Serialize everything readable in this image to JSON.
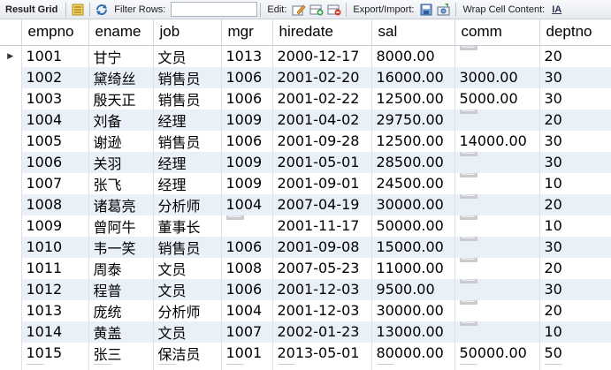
{
  "toolbar": {
    "result_grid_label": "Result Grid",
    "filter_rows_label": "Filter Rows:",
    "filter_value": "",
    "edit_label": "Edit:",
    "export_import_label": "Export/Import:",
    "wrap_cell_label": "Wrap Cell Content:",
    "wrap_icon_text": "IA"
  },
  "grid": {
    "columns": [
      "empno",
      "ename",
      "job",
      "mgr",
      "hiredate",
      "sal",
      "comm",
      "deptno"
    ],
    "null_text": "NULL",
    "current_row_marker": "▶",
    "rows": [
      [
        "1001",
        "甘宁",
        "文员",
        "1013",
        "2000-12-17",
        "8000.00",
        null,
        "20"
      ],
      [
        "1002",
        "黛绮丝",
        "销售员",
        "1006",
        "2001-02-20",
        "16000.00",
        "3000.00",
        "30"
      ],
      [
        "1003",
        "殷天正",
        "销售员",
        "1006",
        "2001-02-22",
        "12500.00",
        "5000.00",
        "30"
      ],
      [
        "1004",
        "刘备",
        "经理",
        "1009",
        "2001-04-02",
        "29750.00",
        null,
        "20"
      ],
      [
        "1005",
        "谢逊",
        "销售员",
        "1006",
        "2001-09-28",
        "12500.00",
        "14000.00",
        "30"
      ],
      [
        "1006",
        "关羽",
        "经理",
        "1009",
        "2001-05-01",
        "28500.00",
        null,
        "30"
      ],
      [
        "1007",
        "张飞",
        "经理",
        "1009",
        "2001-09-01",
        "24500.00",
        null,
        "10"
      ],
      [
        "1008",
        "诸葛亮",
        "分析师",
        "1004",
        "2007-04-19",
        "30000.00",
        null,
        "20"
      ],
      [
        "1009",
        "曾阿牛",
        "董事长",
        null,
        "2001-11-17",
        "50000.00",
        null,
        "10"
      ],
      [
        "1010",
        "韦一笑",
        "销售员",
        "1006",
        "2001-09-08",
        "15000.00",
        null,
        "30"
      ],
      [
        "1011",
        "周泰",
        "文员",
        "1008",
        "2007-05-23",
        "11000.00",
        null,
        "20"
      ],
      [
        "1012",
        "程普",
        "文员",
        "1006",
        "2001-12-03",
        "9500.00",
        null,
        "30"
      ],
      [
        "1013",
        "庞统",
        "分析师",
        "1004",
        "2001-12-03",
        "30000.00",
        null,
        "20"
      ],
      [
        "1014",
        "黄盖",
        "文员",
        "1007",
        "2002-01-23",
        "13000.00",
        null,
        "10"
      ],
      [
        "1015",
        "张三",
        "保洁员",
        "1001",
        "2013-05-01",
        "80000.00",
        "50000.00",
        "50"
      ]
    ]
  }
}
